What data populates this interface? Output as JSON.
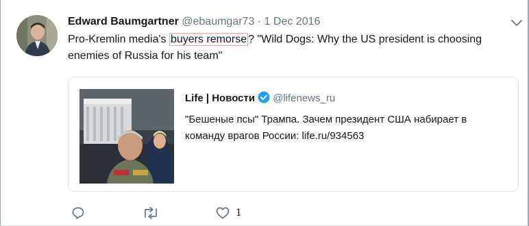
{
  "tweet": {
    "author_name": "Edward Baumgartner",
    "author_handle": "@ebaumgar73",
    "separator": " · ",
    "date": "1 Dec 2016",
    "text_before": "Pro-Kremlin media's ",
    "text_highlight": "buyers remorse",
    "text_after": "? \"Wild Dogs: Why the US president is choosing enemies of Russia for his team\""
  },
  "quoted": {
    "name": "Life | Новости",
    "handle": "@lifenews_ru",
    "text": "\"Бешеные псы\" Трампа. Зачем президент США набирает в команду врагов России: life.ru/934563"
  },
  "actions": {
    "reply_icon": "reply-icon",
    "retweet_icon": "retweet-icon",
    "like_icon": "heart-icon",
    "like_count": "1"
  },
  "colors": {
    "text_primary": "#14171a",
    "text_secondary": "#657786",
    "verified_blue": "#1da1f2",
    "card_border": "#e1e8ed",
    "highlight_box": "#e7a6a6"
  }
}
